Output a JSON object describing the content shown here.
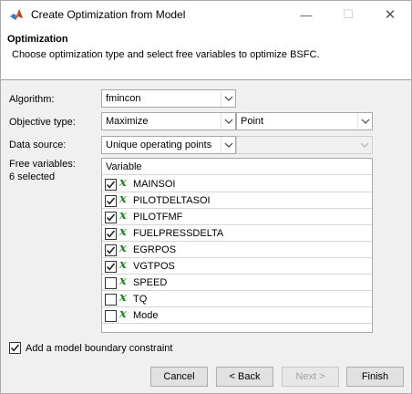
{
  "window": {
    "title": "Create Optimization from Model",
    "min_glyph": "—",
    "max_glyph": "☐",
    "close_glyph": "✕"
  },
  "header": {
    "title": "Optimization",
    "subtitle": "Choose optimization type and select free variables to optimize BSFC."
  },
  "form": {
    "algorithm_label": "Algorithm:",
    "algorithm_value": "fmincon",
    "objective_label": "Objective type:",
    "objective_value": "Maximize",
    "objective_mode_value": "Point",
    "data_source_label": "Data source:",
    "data_source_value": "Unique operating points",
    "data_source_secondary_value": "",
    "free_vars_label": "Free variables:",
    "free_vars_count": "6 selected"
  },
  "table": {
    "column_header": "Variable",
    "rows": [
      {
        "name": "MAINSOI",
        "checked": true
      },
      {
        "name": "PILOTDELTASOI",
        "checked": true
      },
      {
        "name": "PILOTFMF",
        "checked": true
      },
      {
        "name": "FUELPRESSDELTA",
        "checked": true
      },
      {
        "name": "EGRPOS",
        "checked": true
      },
      {
        "name": "VGTPOS",
        "checked": true
      },
      {
        "name": "SPEED",
        "checked": false
      },
      {
        "name": "TQ",
        "checked": false
      },
      {
        "name": "Mode",
        "checked": false
      }
    ],
    "var_glyph": "x"
  },
  "boundary": {
    "label": "Add a model boundary constraint",
    "checked": true
  },
  "buttons": {
    "cancel": "Cancel",
    "back": "< Back",
    "next": "Next >",
    "finish": "Finish"
  },
  "icons": {
    "app": "matlab-icon",
    "dropdown": "chevron-down-icon",
    "check": "checkmark-icon",
    "variable": "x-variable-icon"
  },
  "colors": {
    "variable_glyph": "#1a8a1a",
    "header_bg": "#ffffff",
    "dialog_bg": "#f0f0f0"
  }
}
